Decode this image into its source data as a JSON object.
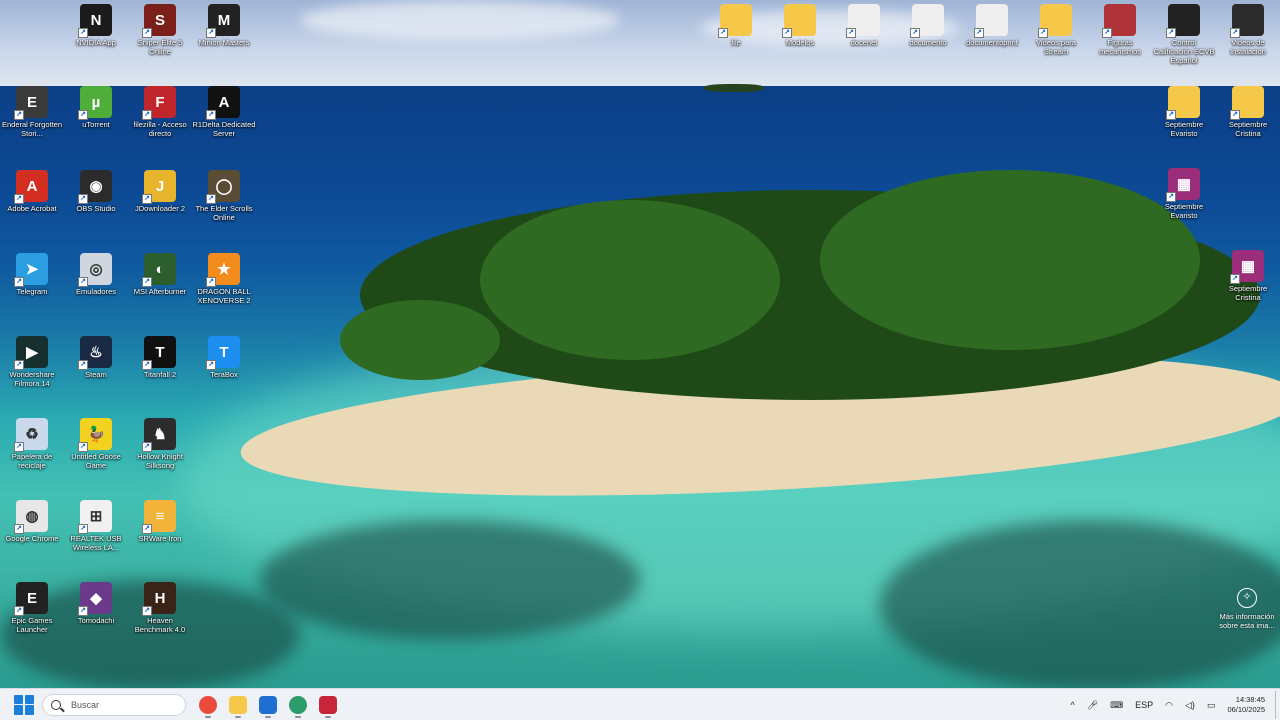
{
  "desktop": {
    "left_icons": [
      {
        "label": "NVIDIA App",
        "color": "#1b1b1b",
        "glyph": "N"
      },
      {
        "label": "Sniper Elite 5 Online",
        "color": "#7a1f1a",
        "glyph": "S"
      },
      {
        "label": "Minion Masters",
        "color": "#222222",
        "glyph": "M"
      },
      {
        "label": "Enderal Forgotten Stori...",
        "color": "#3a3a3a",
        "glyph": "E"
      },
      {
        "label": "uTorrent",
        "color": "#4fae3a",
        "glyph": "µ"
      },
      {
        "label": "filezilla - Acceso directo",
        "color": "#c0262b",
        "glyph": "F"
      },
      {
        "label": "R1Delta Dedicated Server",
        "color": "#111111",
        "glyph": "A"
      },
      {
        "label": "Adobe Acrobat",
        "color": "#d42e22",
        "glyph": "A"
      },
      {
        "label": "OBS Studio",
        "color": "#2b2b2b",
        "glyph": "◉"
      },
      {
        "label": "JDownloader 2",
        "color": "#e7b42b",
        "glyph": "J"
      },
      {
        "label": "The Elder Scrolls Online",
        "color": "#5b4c36",
        "glyph": "◯"
      },
      {
        "label": "Telegram",
        "color": "#2a9ee0",
        "glyph": "➤"
      },
      {
        "label": "Emuladores",
        "color": "#cfd6df",
        "glyph": "◎"
      },
      {
        "label": "MSI Afterburner",
        "color": "#2c5e2d",
        "glyph": "◐"
      },
      {
        "label": "DRAGON BALL XENOVERSE 2",
        "color": "#f28c1d",
        "glyph": "★"
      },
      {
        "label": "Wondershare Filmora 14",
        "color": "#15302e",
        "glyph": "▶"
      },
      {
        "label": "Steam",
        "color": "#1b2a44",
        "glyph": "♨"
      },
      {
        "label": "Titanfall 2",
        "color": "#101010",
        "glyph": "T"
      },
      {
        "label": "TeraBox",
        "color": "#1b8ef0",
        "glyph": "T"
      },
      {
        "label": "Papelera de reciclaje",
        "color": "#c8d9ec",
        "glyph": "♻"
      },
      {
        "label": "Untitled Goose Game",
        "color": "#f2d21e",
        "glyph": "🦆"
      },
      {
        "label": "Hollow Knight Silksong",
        "color": "#2c2c2c",
        "glyph": "♞"
      },
      {
        "label": "Google Chrome",
        "color": "#e7e7e7",
        "glyph": "◍"
      },
      {
        "label": "REALTEK USB Wireless LA...",
        "color": "#f0f0f0",
        "glyph": "⊞"
      },
      {
        "label": "SRWare Iron",
        "color": "#f2b33a",
        "glyph": "≡"
      },
      {
        "label": "Epic Games Launcher",
        "color": "#222222",
        "glyph": "E"
      },
      {
        "label": "Tomodachi",
        "color": "#6b3a8a",
        "glyph": "◆"
      },
      {
        "label": "Heaven Benchmark 4.0",
        "color": "#3a2418",
        "glyph": "H"
      }
    ],
    "top_icons": [
      {
        "label": "file",
        "color": "#f5c84a",
        "glyph": ""
      },
      {
        "label": "Modelos",
        "color": "#f5c84a",
        "glyph": ""
      },
      {
        "label": "docenet",
        "color": "#eeeeee",
        "glyph": ""
      },
      {
        "label": "documento",
        "color": "#eeeeee",
        "glyph": ""
      },
      {
        "label": "documentoprint",
        "color": "#eeeeee",
        "glyph": ""
      },
      {
        "label": "Videos para Stream",
        "color": "#f5c84a",
        "glyph": ""
      },
      {
        "label": "Figuras mecanismos",
        "color": "#b0333a",
        "glyph": ""
      },
      {
        "label": "Control Calificación ECVB Español",
        "color": "#222222",
        "glyph": ""
      },
      {
        "label": "Videos de Instalacion",
        "color": "#2b2b2b",
        "glyph": ""
      }
    ],
    "right_icons": [
      {
        "label": "Septiembre Evaristo",
        "color": "#f5c84a",
        "glyph": ""
      },
      {
        "label": "Septiembre Cristina",
        "color": "#f5c84a",
        "glyph": ""
      },
      {
        "label": "Septiembre Evaristo",
        "color": "#9b2d7a",
        "glyph": "▦"
      },
      {
        "label": "Septiembre Cristina",
        "color": "#9b2d7a",
        "glyph": "▦"
      }
    ],
    "info_widget": {
      "glyph": "✧",
      "label": "Más información sobre esta ima..."
    }
  },
  "taskbar": {
    "search_placeholder": "Buscar",
    "apps": [
      {
        "name": "chrome",
        "color": "#e84b3c"
      },
      {
        "name": "file-explorer",
        "color": "#f5c84a"
      },
      {
        "name": "store",
        "color": "#1d6fd1"
      },
      {
        "name": "edge",
        "color": "#2c9c6a"
      },
      {
        "name": "app",
        "color": "#c7263a"
      }
    ],
    "tray": {
      "chevron": "^",
      "language": "ESP",
      "time": "14:38:45",
      "date": "06/10/2025"
    }
  }
}
